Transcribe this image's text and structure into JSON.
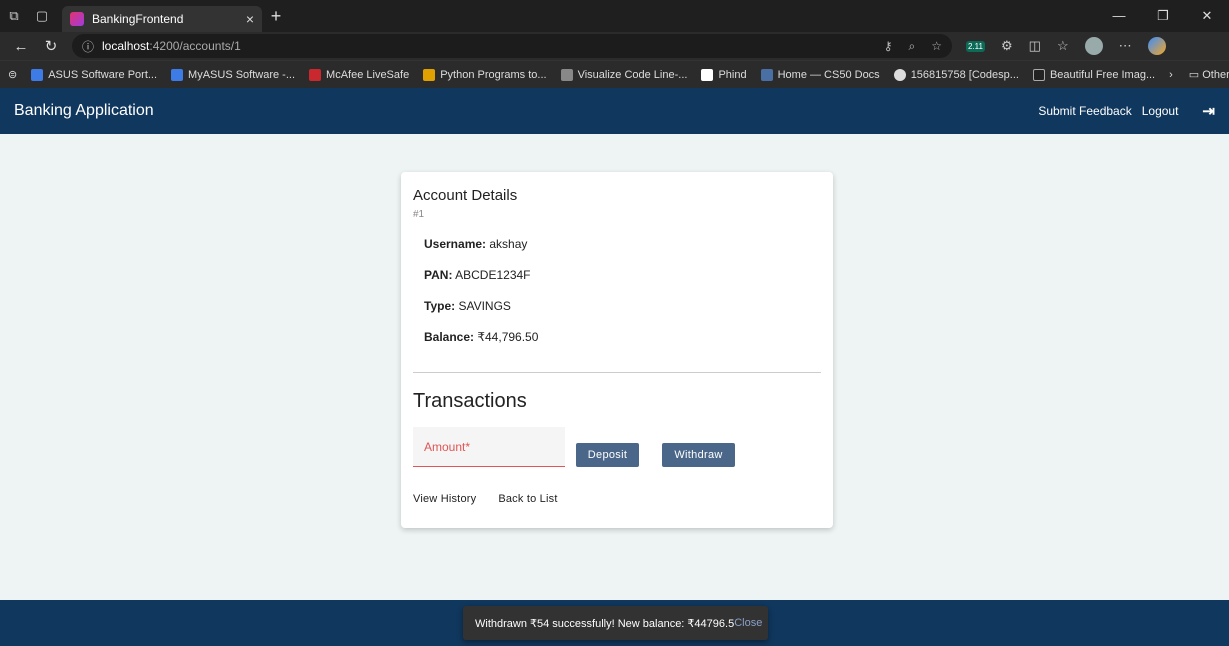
{
  "browser": {
    "tab_title": "BankingFrontend",
    "url_host": "localhost",
    "url_path": ":4200/accounts/1",
    "extension_badge": "2.11",
    "favorites": [
      "ASUS Software Port...",
      "MyASUS Software -...",
      "McAfee LiveSafe",
      "Python Programs to...",
      "Visualize Code Line-...",
      "Phind",
      "Home — CS50 Docs",
      "156815758 [Codesp...",
      "Beautiful Free Imag..."
    ],
    "other_favorites": "Other favorites"
  },
  "header": {
    "title": "Banking Application",
    "feedback": "Submit Feedback",
    "logout": "Logout"
  },
  "account": {
    "title": "Account Details",
    "id": "#1",
    "username_label": "Username:",
    "username": "akshay",
    "pan_label": "PAN:",
    "pan": "ABCDE1234F",
    "type_label": "Type:",
    "type": "SAVINGS",
    "balance_label": "Balance:",
    "balance": "₹44,796.50"
  },
  "transactions": {
    "title": "Transactions",
    "amount_placeholder": "Amount*",
    "deposit": "Deposit",
    "withdraw": "Withdraw",
    "view_history": "View History",
    "back_to_list": "Back to List"
  },
  "snackbar": {
    "message": "Withdrawn ₹54 successfully! New balance: ₹44796.5",
    "close": "Close"
  },
  "colors": {
    "header_bg": "#10375d",
    "button_bg": "#4a6789",
    "error": "#e05555"
  }
}
